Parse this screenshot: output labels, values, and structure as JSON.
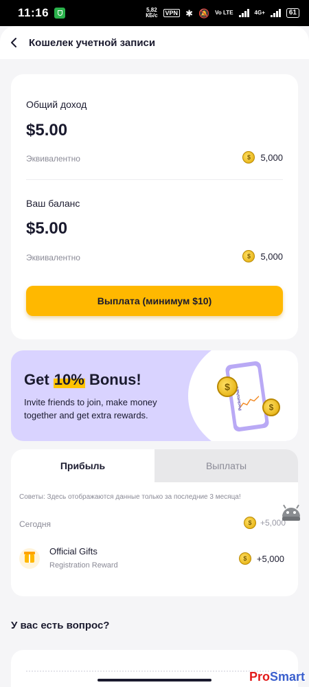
{
  "status_bar": {
    "time": "11:16",
    "net_speed_top": "5,82",
    "net_speed_bottom": "КБ/с",
    "vpn": "VPN",
    "volte": "Vo LTE",
    "network": "4G+",
    "battery": "61"
  },
  "header": {
    "title": "Кошелек учетной записи"
  },
  "wallet": {
    "total_income_label": "Общий доход",
    "total_income_amount": "$5.00",
    "total_equiv_label": "Эквивалентно",
    "total_coins": "5,000",
    "balance_label": "Ваш баланс",
    "balance_amount": "$5.00",
    "balance_equiv_label": "Эквивалентно",
    "balance_coins": "5,000",
    "payout_button": "Выплата (минимум $10)"
  },
  "bonus_banner": {
    "title_prefix": "Get ",
    "title_highlight": "10%",
    "title_suffix": " Bonus!",
    "description": "Invite friends to join, make money together and get extra rewards.",
    "phone_label": "Pocketshare"
  },
  "history": {
    "tabs": [
      {
        "label": "Прибыль",
        "active": true
      },
      {
        "label": "Выплаты",
        "active": false
      }
    ],
    "tip": "Советы: Здесь отображаются данные только за последние 3 месяца!",
    "day_label": "Сегодня",
    "day_value": "+5,000",
    "entries": [
      {
        "title": "Official Gifts",
        "subtitle": "Registration Reward",
        "value": "+5,000"
      }
    ]
  },
  "faq": {
    "heading": "У вас есть вопрос?"
  },
  "watermark": {
    "part1": "Pro",
    "part2": "Smart"
  },
  "colors": {
    "accent": "#ffb800",
    "banner_bg": "#d9d3ff",
    "text_primary": "#1a1a2e",
    "text_secondary": "#8a8a96"
  }
}
